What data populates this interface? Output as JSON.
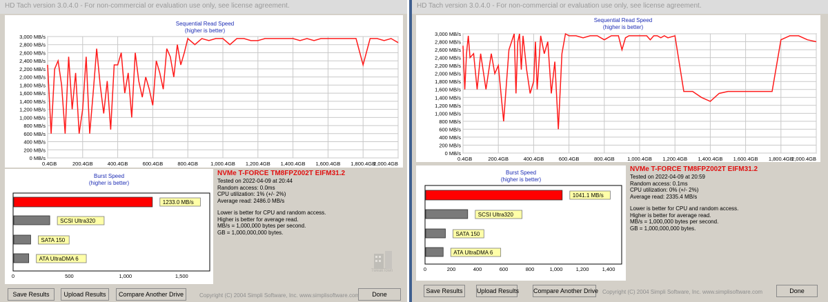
{
  "colors": {
    "line": "#ff1a1a",
    "burst_main": "#ff0000",
    "burst_ref": "#7a7a7a",
    "label_bg": "#ffffa8",
    "grid": "#c8c8c8",
    "title_blue": "#1c2cb4",
    "drive_red": "#e01010"
  },
  "windows": [
    {
      "title": "HD Tach version 3.0.4.0  -  For non-commercial or evaluation use only, see license agreement.",
      "seq_title": "Sequential Read Speed",
      "seq_subtitle": "(higher is better)",
      "burst_title": "Burst Speed",
      "burst_subtitle": "(higher is better)",
      "info": {
        "drive": "NVMe T-FORCE TM8FPZ002T EIFM31.2",
        "tested": "Tested on 2022-04-09 at 20:44",
        "random": "Random access: 0.0ms",
        "cpu": "CPU utilization: 1% (+/- 2%)",
        "avg": "Average read: 2486.0 MB/s",
        "note1": "Lower is better for CPU and random access.",
        "note2": "Higher is better for average read.",
        "note3": "MB/s = 1,000,000 bytes per second.",
        "note4": "GB = 1,000,000,000 bytes."
      },
      "buttons": {
        "save": "Save Results",
        "upload": "Upload Results",
        "compare": "Compare Another Drive",
        "done": "Done"
      },
      "copyright": "Copyright (C) 2004 Simpli Software, Inc. www.simplisoftware.com",
      "watermark": "TweakTown"
    },
    {
      "title": "HD Tach version 3.0.4.0  -  For non-commercial or evaluation use only, see license agreement.",
      "seq_title": "Sequential Read Speed",
      "seq_subtitle": "(higher is better)",
      "burst_title": "Burst Speed",
      "burst_subtitle": "(higher is better)",
      "info": {
        "drive": "NVMe T-FORCE TM8FPZ002T EIFM31.2",
        "tested": "Tested on 2022-04-09 at 20:59",
        "random": "Random access: 0.1ms",
        "cpu": "CPU utilization: 0% (+/- 2%)",
        "avg": "Average read: 2335.4 MB/s",
        "note1": "Lower is better for CPU and random access.",
        "note2": "Higher is better for average read.",
        "note3": "MB/s = 1,000,000 bytes per second.",
        "note4": "GB = 1,000,000,000 bytes."
      },
      "buttons": {
        "save": "Save Results",
        "upload": "Upload Results",
        "compare": "Compare Another Drive",
        "done": "Done"
      },
      "copyright": "Copyright (C) 2004 Simpli Software, Inc. www.simplisoftware.com"
    }
  ],
  "chart_data": [
    {
      "type": "line",
      "title": "Sequential Read Speed",
      "subtitle": "(higher is better)",
      "xlim": [
        0.4,
        2000.4
      ],
      "ylim": [
        0,
        3000
      ],
      "x_ticks": [
        "0.4GB",
        "200.4GB",
        "400.4GB",
        "600.4GB",
        "800.4GB",
        "1,000.4GB",
        "1,200.4GB",
        "1,400.4GB",
        "1,600.4GB",
        "1,800.4GB",
        "2,000.4GB"
      ],
      "y_ticks": [
        "0 MB/s",
        "200 MB/s",
        "400 MB/s",
        "600 MB/s",
        "800 MB/s",
        "1,000 MB/s",
        "1,200 MB/s",
        "1,400 MB/s",
        "1,600 MB/s",
        "1,800 MB/s",
        "2,000 MB/s",
        "2,200 MB/s",
        "2,400 MB/s",
        "2,600 MB/s",
        "2,800 MB/s",
        "3,000 MB/s"
      ],
      "grid": true,
      "x": [
        0,
        20,
        40,
        60,
        80,
        100,
        120,
        140,
        160,
        180,
        200,
        220,
        240,
        260,
        280,
        300,
        320,
        340,
        360,
        380,
        400,
        420,
        440,
        460,
        480,
        500,
        520,
        540,
        560,
        580,
        600,
        620,
        640,
        660,
        680,
        700,
        720,
        740,
        760,
        780,
        800,
        840,
        880,
        920,
        960,
        1000,
        1040,
        1080,
        1120,
        1160,
        1200,
        1240,
        1280,
        1320,
        1360,
        1400,
        1440,
        1480,
        1520,
        1560,
        1600,
        1640,
        1680,
        1720,
        1760,
        1800,
        1840,
        1880,
        1920,
        1960,
        2000
      ],
      "series": [
        {
          "values": [
            2300,
            600,
            2200,
            2400,
            1800,
            600,
            2500,
            1200,
            2100,
            600,
            1200,
            2500,
            600,
            1600,
            2700,
            1800,
            1100,
            1900,
            700,
            2300,
            2300,
            2600,
            1600,
            2100,
            1000,
            2600,
            1900,
            1500,
            2000,
            1700,
            1300,
            2400,
            2100,
            1700,
            2700,
            2500,
            2000,
            2800,
            2300,
            2600,
            2950,
            2800,
            2950,
            2900,
            2950,
            2950,
            2800,
            2950,
            2950,
            2900,
            2900,
            2950,
            2950,
            2950,
            2950,
            2950,
            2900,
            2950,
            2900,
            2950,
            2950,
            2950,
            2950,
            2950,
            2950,
            2300,
            2950,
            2950,
            2900,
            2950,
            2850
          ]
        }
      ]
    },
    {
      "type": "bar",
      "title": "Burst Speed",
      "subtitle": "(higher is better)",
      "categories": [
        "NVMe T-FORCE TM8FPZ002T EIFM31.2",
        "SCSI Ultra320",
        "SATA 150",
        "ATA UltraDMA 6"
      ],
      "values": [
        1233.0,
        320,
        150,
        133
      ],
      "value_label": "1233.0 MB/s",
      "xlim": [
        0,
        1750
      ],
      "x_ticks": [
        "0",
        "500",
        "1,000",
        "1,500"
      ]
    },
    {
      "type": "line",
      "title": "Sequential Read Speed",
      "subtitle": "(higher is better)",
      "xlim": [
        0.4,
        2000.4
      ],
      "ylim": [
        0,
        3000
      ],
      "x_ticks": [
        "0.4GB",
        "200.4GB",
        "400.4GB",
        "600.4GB",
        "800.4GB",
        "1,000.4GB",
        "1,200.4GB",
        "1,400.4GB",
        "1,600.4GB",
        "1,800.4GB",
        "2,000.4GB"
      ],
      "y_ticks": [
        "0 MB/s",
        "200 MB/s",
        "400 MB/s",
        "600 MB/s",
        "800 MB/s",
        "1,000 MB/s",
        "1,200 MB/s",
        "1,400 MB/s",
        "1,600 MB/s",
        "1,800 MB/s",
        "2,000 MB/s",
        "2,200 MB/s",
        "2,400 MB/s",
        "2,600 MB/s",
        "2,800 MB/s",
        "3,000 MB/s"
      ],
      "grid": true,
      "x": [
        0,
        10,
        20,
        30,
        40,
        60,
        80,
        100,
        130,
        160,
        180,
        200,
        230,
        260,
        290,
        300,
        310,
        320,
        330,
        340,
        360,
        380,
        400,
        410,
        420,
        440,
        460,
        480,
        500,
        520,
        540,
        560,
        580,
        600,
        640,
        680,
        720,
        760,
        800,
        840,
        880,
        900,
        920,
        940,
        960,
        980,
        1000,
        1020,
        1040,
        1060,
        1080,
        1100,
        1120,
        1140,
        1160,
        1200,
        1250,
        1300,
        1350,
        1400,
        1450,
        1500,
        1550,
        1600,
        1650,
        1700,
        1750,
        1800,
        1850,
        1900,
        1950,
        2000
      ],
      "series": [
        {
          "values": [
            2700,
            1600,
            2500,
            2950,
            2400,
            2500,
            1600,
            2500,
            1600,
            2500,
            2000,
            2200,
            800,
            2600,
            3000,
            1500,
            2800,
            3000,
            2100,
            2950,
            2100,
            1500,
            1800,
            2800,
            1600,
            2950,
            2500,
            2800,
            1500,
            2300,
            600,
            2500,
            3000,
            2950,
            2950,
            2900,
            2950,
            2950,
            2850,
            2950,
            2950,
            2600,
            2900,
            2950,
            2950,
            2950,
            2950,
            2950,
            2950,
            2850,
            2950,
            2950,
            2900,
            2950,
            2900,
            2950,
            1550,
            1550,
            1400,
            1300,
            1500,
            1550,
            1550,
            1550,
            1550,
            1550,
            1550,
            2850,
            2950,
            2950,
            2850,
            2800
          ]
        }
      ]
    },
    {
      "type": "bar",
      "title": "Burst Speed",
      "subtitle": "(higher is better)",
      "categories": [
        "NVMe T-FORCE TM8FPZ002T EIFM31.2",
        "SCSI Ultra320",
        "SATA 150",
        "ATA UltraDMA 6"
      ],
      "values": [
        1041.1,
        320,
        150,
        133
      ],
      "value_label": "1041.1 MB/s",
      "xlim": [
        0,
        1500
      ],
      "x_ticks": [
        "0",
        "200",
        "400",
        "600",
        "800",
        "1,000",
        "1,200",
        "1,400"
      ]
    }
  ]
}
